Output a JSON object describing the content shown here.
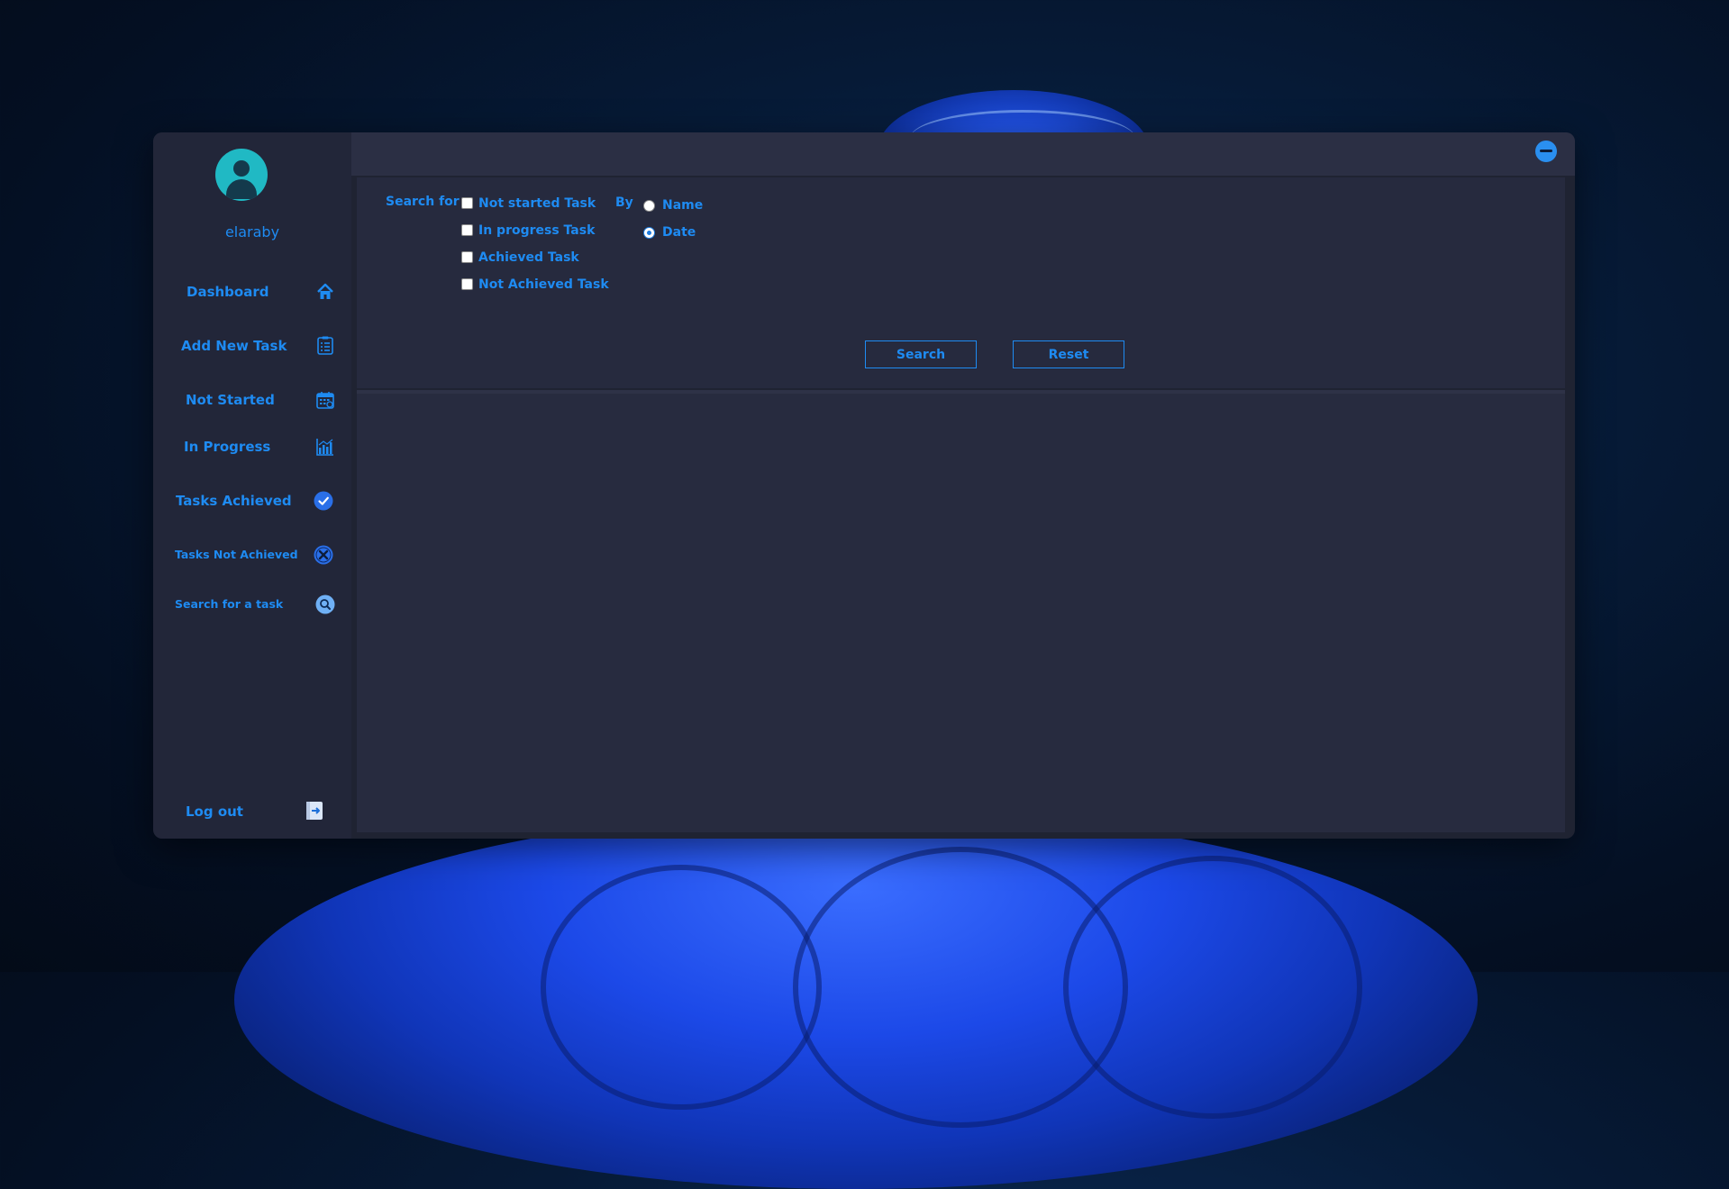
{
  "user": {
    "name": "elaraby"
  },
  "sidebar": {
    "items": [
      {
        "label": "Dashboard",
        "icon": "home-icon"
      },
      {
        "label": "Add New Task",
        "icon": "clipboard-list-icon"
      },
      {
        "label": "Not Started",
        "icon": "calendar-icon"
      },
      {
        "label": "In Progress",
        "icon": "bar-chart-icon"
      },
      {
        "label": "Tasks Achieved",
        "icon": "check-circle-icon"
      },
      {
        "label": "Tasks Not Achieved",
        "icon": "x-circle-icon"
      },
      {
        "label": "Search for a task",
        "icon": "search-circle-icon"
      }
    ],
    "logout": {
      "label": "Log out",
      "icon": "logout-icon"
    }
  },
  "search": {
    "search_for_label": "Search for",
    "by_label": "By",
    "checkboxes": [
      {
        "label": "Not started Task",
        "checked": false
      },
      {
        "label": "In progress Task",
        "checked": false
      },
      {
        "label": "Achieved Task",
        "checked": false
      },
      {
        "label": "Not Achieved Task",
        "checked": false
      }
    ],
    "radios": [
      {
        "label": "Name",
        "checked": false
      },
      {
        "label": "Date",
        "checked": true
      }
    ],
    "search_button": "Search",
    "reset_button": "Reset"
  },
  "colors": {
    "accent": "#1e8bf2",
    "sidebar_bg": "#222639",
    "panel_bg": "#262a3e",
    "avatar": "#20b9c4"
  }
}
